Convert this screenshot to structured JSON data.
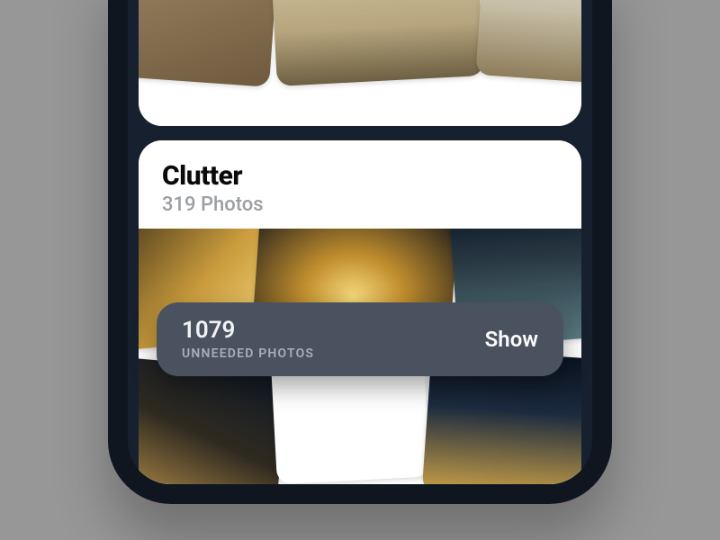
{
  "sections": {
    "clutter": {
      "title": "Clutter",
      "subtitle": "319 Photos"
    }
  },
  "status_pill": {
    "count": "1079",
    "label": "UNNEEDED PHOTOS",
    "action": "Show"
  }
}
